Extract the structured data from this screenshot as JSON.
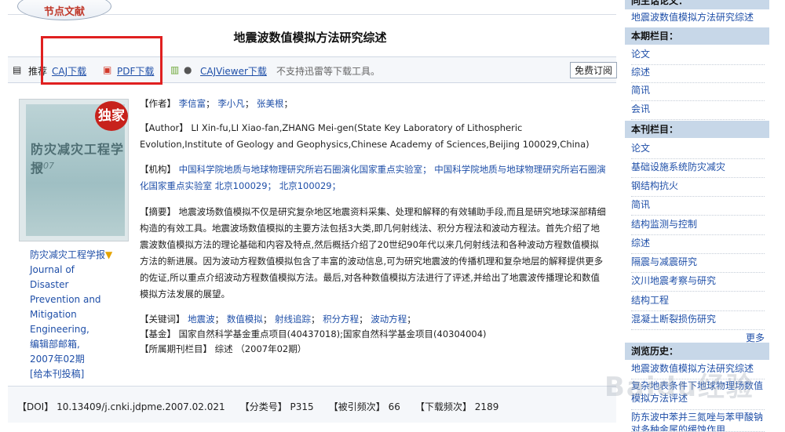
{
  "header": {
    "tag_label": "节点文献",
    "title": "地震波数值模拟方法研究综述"
  },
  "toolbar": {
    "recommend": "推荐",
    "caj_download": "CAJ下载",
    "pdf_download": "PDF下载",
    "cajviewer": "CAJViewer下载",
    "notice": "不支持迅雷等下载工具。",
    "subscribe": "免费订阅"
  },
  "cover": {
    "badge": "独家",
    "title": "防灾减灾工程学报",
    "year": "2007"
  },
  "journal": {
    "name_cn": "防灾减灾工程学报",
    "name_en": "Journal of Disaster Prevention and Mitigation Engineering,",
    "dept": "编辑部邮箱,",
    "issue": "2007年02期",
    "submit": "[给本刊投稿]"
  },
  "article": {
    "author_label": "【作者】",
    "authors": [
      "李信富",
      "李小凡",
      "张美根"
    ],
    "author_en_label": "【Author】",
    "author_en": "LI Xin-fu,LI Xiao-fan,ZHANG Mei-gen(State Key Laboratory of Lithospheric Evolution,Institute of Geology and Geophysics,Chinese Academy of Sciences,Beijing 100029,China)",
    "org_label": "【机构】",
    "org": "中国科学院地质与地球物理研究所岩石圈演化国家重点实验室； 中国科学院地质与地球物理研究所岩石圈演化国家重点实验室 北京100029； 北京100029；",
    "abstract_label": "【摘要】",
    "abstract": "地震波场数值模拟不仅是研究复杂地区地震资料采集、处理和解释的有效辅助手段,而且是研究地球深部精细构造的有效工具。地震波场数值模拟的主要方法包括3大类,即几何射线法、积分方程法和波动方程法。首先介绍了地震波数值模拟方法的理论基础和内容及特点,然后概括介绍了20世纪90年代以来几何射线法和各种波动方程数值模拟方法的新进展。因为波动方程数值模拟包含了丰富的波动信息,可为研究地震波的传播机理和复杂地层的解释提供更多的佐证,所以重点介绍波动方程数值模拟方法。最后,对各种数值模拟方法进行了评述,并给出了地震波传播理论和数值模拟方法发展的展望。",
    "keywords_label": "【关键词】",
    "keywords": [
      "地震波",
      "数值模拟",
      "射线追踪",
      "积分方程",
      "波动方程"
    ],
    "fund_label": "【基金】",
    "fund": "国家自然科学基金重点项目(40437018);国家自然科学基金项目(40304004)",
    "column_label": "【所属期刊栏目】",
    "column": "综述 （2007年02期）"
  },
  "footer": {
    "doi_label": "【DOI】",
    "doi": "10.13409/j.cnki.jdpme.2007.02.021",
    "class_label": "【分类号】",
    "class": "P315",
    "cited_label": "【被引频次】",
    "cited": "66",
    "downloads_label": "【下载频次】",
    "downloads": "2189"
  },
  "sidebar": {
    "top_head": "同主话论文：",
    "top_item": "地震波数值模拟方法研究综述",
    "issue_head": "本期栏目：",
    "issue_items": [
      "论文",
      "综述",
      "简讯",
      "会讯"
    ],
    "journal_head": "本刊栏目：",
    "journal_items": [
      "论文",
      "基础设施系统防灾减灾",
      "钢结构抗火",
      "简讯",
      "结构监测与控制",
      "综述",
      "隔震与减震研究",
      "汶川地震考察与研究",
      "结构工程",
      "混凝土断裂损伤研究"
    ],
    "more": "更多",
    "history_head": "浏览历史：",
    "history_items": [
      "地震波数值模拟方法研究综述",
      "复杂地表条件下地球物理场数值模拟方法评述",
      "防东波中苯并三氮唑与苯甲酸钠对多种金属的缓蚀作用"
    ]
  },
  "watermark": "Baidu经验"
}
